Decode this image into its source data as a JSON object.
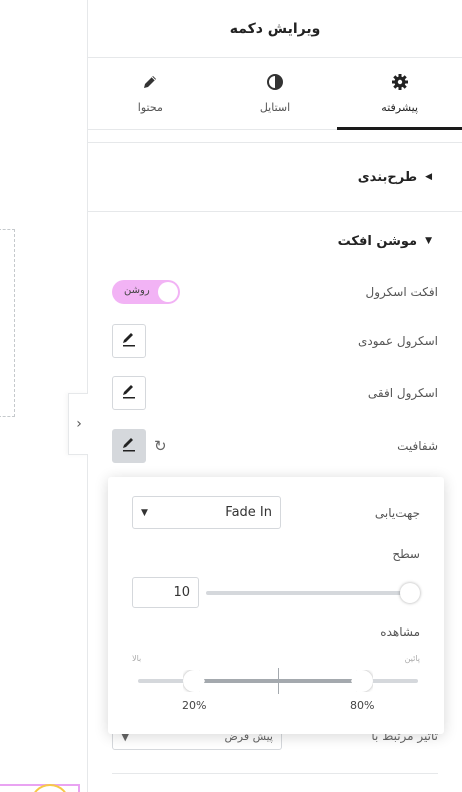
{
  "panel": {
    "title": "ویرایش دکمه",
    "tabs": [
      {
        "label": "پیشرفته",
        "icon": "gear-icon"
      },
      {
        "label": "استایل",
        "icon": "half-circle-icon"
      },
      {
        "label": "محتوا",
        "icon": "pencil-icon"
      }
    ],
    "active_tab": "پیشرفته"
  },
  "sections": {
    "layout": "طرح‌بندی",
    "motion": "موشن افکت"
  },
  "controls": {
    "scroll_effect": {
      "label": "افکت اسکرول",
      "toggle": "روشن",
      "enabled": true
    },
    "vertical_scroll": {
      "label": "اسکرول عمودی"
    },
    "horizontal_scroll": {
      "label": "اسکرول افقی"
    },
    "opacity": {
      "label": "شفافیت"
    },
    "effects_relative_to": {
      "label": "تاثیر مرتبط با",
      "value": "پیش فرض"
    }
  },
  "popover": {
    "direction": {
      "label": "جهت‌یابی",
      "value": "Fade In"
    },
    "level": {
      "label": "سطح",
      "value": "10",
      "fraction": 1.0
    },
    "viewport": {
      "label": "مشاهده",
      "bottom_label": "پائین",
      "top_label": "بالا",
      "start": "20%",
      "end": "80%",
      "start_fraction": 0.2,
      "end_fraction": 0.8
    }
  },
  "colors": {
    "toggle_on": "#f2b3f5",
    "accent_dark": "#1a1a1a"
  }
}
